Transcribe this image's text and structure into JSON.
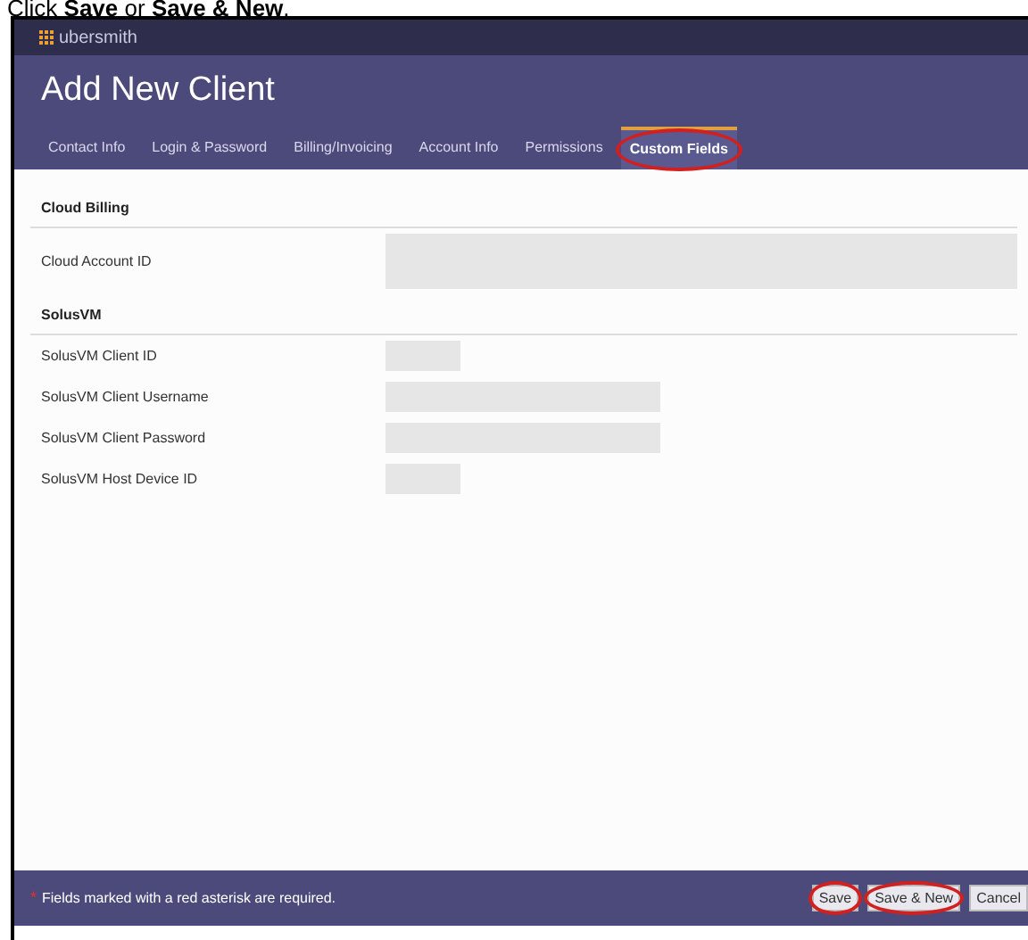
{
  "caption": "Click **Save** or **Save & New**.",
  "app": {
    "brand": "ubersmith",
    "title": "Add New Client"
  },
  "tabs": [
    {
      "label": "Contact Info",
      "selected": false,
      "circled": false
    },
    {
      "label": "Login & Password",
      "selected": false,
      "circled": false
    },
    {
      "label": "Billing/Invoicing",
      "selected": false,
      "circled": false
    },
    {
      "label": "Account Info",
      "selected": false,
      "circled": false
    },
    {
      "label": "Permissions",
      "selected": false,
      "circled": false
    },
    {
      "label": "Custom Fields",
      "selected": true,
      "circled": true
    }
  ],
  "sections": [
    {
      "title": "Cloud Billing",
      "fields": [
        {
          "label": "Cloud Account ID",
          "kind": "textarea"
        }
      ]
    },
    {
      "title": "SolusVM",
      "fields": [
        {
          "label": "SolusVM Client ID",
          "kind": "short"
        },
        {
          "label": "SolusVM Client Username",
          "kind": "long"
        },
        {
          "label": "SolusVM Client Password",
          "kind": "long"
        },
        {
          "label": "SolusVM Host Device ID",
          "kind": "short"
        }
      ]
    }
  ],
  "footer": {
    "asterisk": "*",
    "note": "Fields marked with a red asterisk are required.",
    "buttons": [
      {
        "label": "Save",
        "circled": true
      },
      {
        "label": "Save & New",
        "circled": true
      },
      {
        "label": "Cancel",
        "circled": false
      }
    ]
  }
}
